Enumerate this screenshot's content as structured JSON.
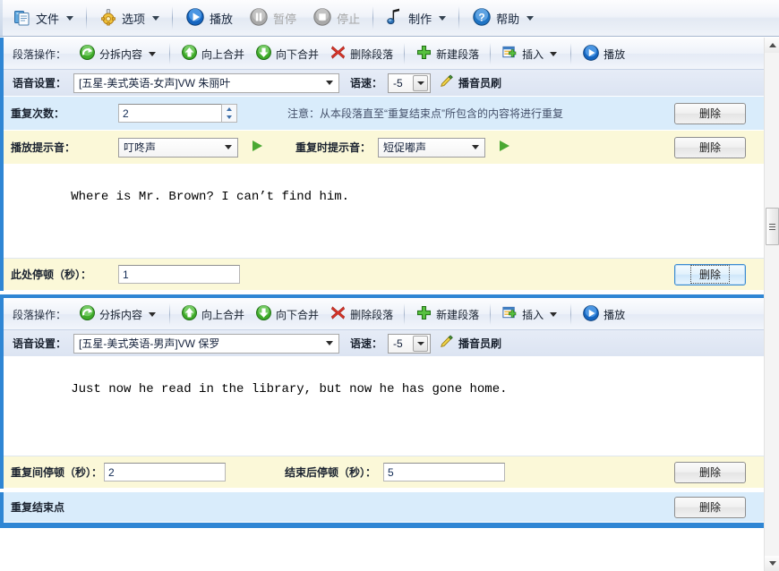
{
  "menubar": {
    "items": [
      {
        "name": "file",
        "label": "文件",
        "icon": "file-icon",
        "caret": true,
        "disabled": false
      },
      {
        "name": "options",
        "label": "选项",
        "icon": "gear-icon",
        "caret": true,
        "disabled": false
      },
      {
        "name": "play",
        "label": "播放",
        "icon": "play-icon",
        "caret": false,
        "disabled": false
      },
      {
        "name": "pause",
        "label": "暂停",
        "icon": "pause-icon",
        "caret": false,
        "disabled": true
      },
      {
        "name": "stop",
        "label": "停止",
        "icon": "stop-icon",
        "caret": false,
        "disabled": true
      },
      {
        "name": "produce",
        "label": "制作",
        "icon": "music-note-icon",
        "caret": true,
        "disabled": false
      },
      {
        "name": "help",
        "label": "帮助",
        "icon": "help-icon",
        "caret": true,
        "disabled": false
      }
    ]
  },
  "paragraph_toolbar": {
    "label": "段落操作：",
    "split_label": "分拆内容",
    "merge_up_label": "向上合并",
    "merge_down_label": "向下合并",
    "delete_paragraph_label": "删除段落",
    "new_paragraph_label": "新建段落",
    "insert_label": "插入",
    "play_label": "播放"
  },
  "common": {
    "voice_label": "语音设置：",
    "speed_label": "语速：",
    "announcer_brush_label": "播音员刷",
    "delete_label": "删除"
  },
  "paragraph1": {
    "voice_value": "[五星-美式英语-女声]VW 朱丽叶",
    "speed_value": "-5",
    "repeat_count_label": "重复次数：",
    "repeat_count_value": "2",
    "repeat_note": "注意：从本段落直至“重复结束点”所包含的内容将进行重复",
    "repeat_delete_label": "删除",
    "cue_label": "播放提示音：",
    "cue_value": "叮咚声",
    "repeat_cue_label": "重复时提示音：",
    "repeat_cue_value": "短促嘟声",
    "cue_delete_label": "删除",
    "text": "Where is Mr. Brown? I can’t find him.",
    "pause_label": "此处停顿（秒）：",
    "pause_value": "1",
    "pause_delete_label": "删除"
  },
  "paragraph2": {
    "voice_value": "[五星-美式英语-男声]VW 保罗",
    "speed_value": "-5",
    "text": "Just now he read in the library, but now he has gone home.",
    "repeat_gap_label": "重复间停顿（秒）：",
    "repeat_gap_value": "2",
    "end_pause_label": "结束后停顿（秒）：",
    "end_pause_value": "5",
    "bottom_delete_label": "删除"
  },
  "repeat_end": {
    "label": "重复结束点",
    "delete_label": "删除"
  },
  "scrollbar": {
    "up_icon": "scroll-up-arrow-icon",
    "down_icon": "scroll-down-arrow-icon",
    "thumb_icon": "scrollbar-thumb"
  },
  "colors": {
    "accent_blue": "#2f86d4",
    "row_blue": "#d9ecfb",
    "row_yellow": "#fbf8d8",
    "toolbar_blue": "#e4eaf5",
    "green": "#3aa52b",
    "red": "#d83b2a"
  }
}
